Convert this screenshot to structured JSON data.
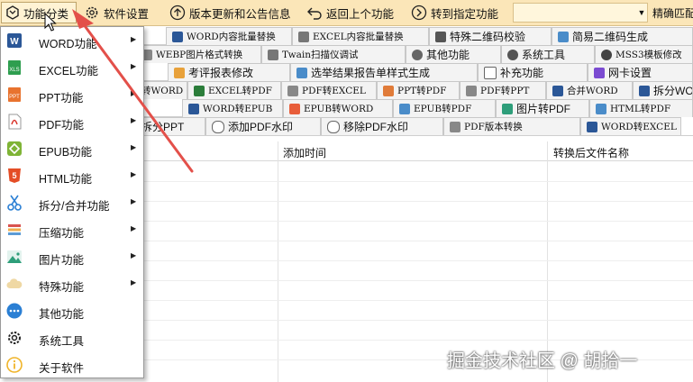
{
  "toolbar": {
    "category": "功能分类",
    "settings": "软件设置",
    "updates": "版本更新和公告信息",
    "back": "返回上个功能",
    "goto": "转到指定功能",
    "match": "精确匹配"
  },
  "tabs": {
    "row1": [
      "WORD内容批量替换",
      "EXCEL内容批量替换",
      "特殊二维码校验",
      "简易二维码生成"
    ],
    "row2": [
      "WEBP图片格式转换",
      "Twain扫描仪调试",
      "其他功能",
      "系统工具",
      "MSS3模板修改"
    ],
    "row3": [
      "考评报表修改",
      "选举结果报告单样式生成",
      "补充功能",
      "网卡设置"
    ],
    "row4": [
      "转WORD",
      "EXCEL转PDF",
      "PDF转EXCEL",
      "PPT转PDF",
      "PDF转PPT",
      "合并WORD",
      "拆分WO"
    ],
    "row5": [
      "WORD转EPUB",
      "EPUB转WORD",
      "EPUB转PDF",
      "图片转PDF",
      "HTML转PDF"
    ],
    "row6": [
      "拆分PPT",
      "添加PDF水印",
      "移除PDF水印",
      "PDF版本转换",
      "WORD转EXCEL"
    ]
  },
  "grid": {
    "col_added": "添加时间",
    "col_converted_name": "转换后文件名称"
  },
  "menu": {
    "items": [
      {
        "label": "WORD功能",
        "icon": "word-icon",
        "arrow": true
      },
      {
        "label": "EXCEL功能",
        "icon": "excel-icon",
        "arrow": true
      },
      {
        "label": "PPT功能",
        "icon": "ppt-icon",
        "arrow": true
      },
      {
        "label": "PDF功能",
        "icon": "pdf-icon",
        "arrow": true
      },
      {
        "label": "EPUB功能",
        "icon": "epub-icon",
        "arrow": true
      },
      {
        "label": "HTML功能",
        "icon": "html5-icon",
        "arrow": true
      },
      {
        "label": "拆分/合并功能",
        "icon": "scissors-icon",
        "arrow": true
      },
      {
        "label": "压缩功能",
        "icon": "compress-icon",
        "arrow": true
      },
      {
        "label": "图片功能",
        "icon": "image-icon",
        "arrow": true
      },
      {
        "label": "特殊功能",
        "icon": "cloud-icon",
        "arrow": true
      },
      {
        "label": "其他功能",
        "icon": "more-icon",
        "arrow": false
      },
      {
        "label": "系统工具",
        "icon": "gear-icon",
        "arrow": false
      },
      {
        "label": "关于软件",
        "icon": "info-icon",
        "arrow": false
      }
    ]
  },
  "watermark": "掘金技术社区 @ 胡拾一",
  "colors": {
    "toolbar_bg": "#fbe6b8",
    "annotation_arrow": "#e3504a"
  }
}
